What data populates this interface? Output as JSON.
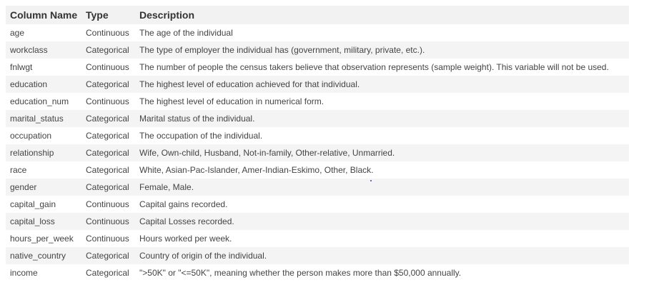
{
  "table": {
    "headers": [
      "Column Name",
      "Type",
      "Description"
    ],
    "rows": [
      [
        "age",
        "Continuous",
        "The age of the individual"
      ],
      [
        "workclass",
        "Categorical",
        "The type of employer the individual has (government, military, private, etc.)."
      ],
      [
        "fnlwgt",
        "Continuous",
        "The number of people the census takers believe that observation represents (sample weight). This variable will not be used."
      ],
      [
        "education",
        "Categorical",
        "The highest level of education achieved for that individual."
      ],
      [
        "education_num",
        "Continuous",
        "The highest level of education in numerical form."
      ],
      [
        "marital_status",
        "Categorical",
        "Marital status of the individual."
      ],
      [
        "occupation",
        "Categorical",
        "The occupation of the individual."
      ],
      [
        "relationship",
        "Categorical",
        "Wife, Own-child, Husband, Not-in-family, Other-relative, Unmarried."
      ],
      [
        "race",
        "Categorical",
        "White, Asian-Pac-Islander, Amer-Indian-Eskimo, Other, Black."
      ],
      [
        "gender",
        "Categorical",
        "Female, Male."
      ],
      [
        "capital_gain",
        "Continuous",
        "Capital gains recorded."
      ],
      [
        "capital_loss",
        "Continuous",
        "Capital Losses recorded."
      ],
      [
        "hours_per_week",
        "Continuous",
        "Hours worked per week."
      ],
      [
        "native_country",
        "Categorical",
        "Country of origin of the individual."
      ],
      [
        "income",
        "Categorical",
        "\">50K\" or \"<=50K\", meaning whether the person makes more than $50,000 annually."
      ]
    ]
  },
  "colors": {
    "header_bg": "#f2f2f2",
    "row_alt_bg": "#f4f4f4",
    "row_bg": "#ffffff",
    "text": "#444444"
  }
}
